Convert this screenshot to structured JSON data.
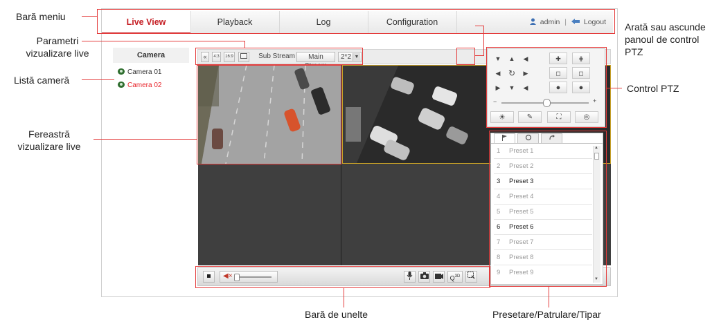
{
  "menu": {
    "tabs": [
      {
        "label": "Live View",
        "active": true
      },
      {
        "label": "Playback",
        "active": false
      },
      {
        "label": "Log",
        "active": false
      },
      {
        "label": "Configuration",
        "active": false
      }
    ],
    "user": "admin",
    "separator": "|",
    "logout": "Logout"
  },
  "camera_panel": {
    "title": "Camera",
    "items": [
      {
        "label": "Camera 01",
        "active": false
      },
      {
        "label": "Camera 02",
        "active": true
      }
    ]
  },
  "liveview_toolbar": {
    "collapse_left": "«",
    "ratio_4_3": "4:3",
    "ratio_16_9": "16:9",
    "sub_stream": "Sub Stream",
    "main_stream": "Main Stream",
    "layout": "2*2",
    "expand_right": "»"
  },
  "bottom_toolbar": {
    "stop_icon": "stop-icon",
    "volume_icon": "speaker-mute-icon",
    "icons": [
      "microphone-icon",
      "camera-icon",
      "record-icon",
      "zoom-icon",
      "capture-region-icon"
    ],
    "zoom_badge": "3D"
  },
  "ptz": {
    "icons": [
      "arrow-nw",
      "arrow-n",
      "arrow-ne",
      "arrow-w",
      "auto-rotate",
      "arrow-e",
      "arrow-sw",
      "arrow-s",
      "arrow-se"
    ],
    "minus": "−",
    "plus": "+"
  },
  "presets": {
    "tabs": [
      "preset-tab",
      "patrol-tab",
      "pattern-tab"
    ],
    "rows": [
      {
        "num": "1",
        "label": "Preset 1",
        "set": false
      },
      {
        "num": "2",
        "label": "Preset 2",
        "set": false
      },
      {
        "num": "3",
        "label": "Preset 3",
        "set": true
      },
      {
        "num": "4",
        "label": "Preset 4",
        "set": false
      },
      {
        "num": "5",
        "label": "Preset 5",
        "set": false
      },
      {
        "num": "6",
        "label": "Preset 6",
        "set": true
      },
      {
        "num": "7",
        "label": "Preset 7",
        "set": false
      },
      {
        "num": "8",
        "label": "Preset 8",
        "set": false
      },
      {
        "num": "9",
        "label": "Preset 9",
        "set": false
      }
    ]
  },
  "callouts": {
    "menu_bar": "Bară meniu",
    "liveview_params": [
      "Parametri",
      "vizualizare live"
    ],
    "camera_list": "Listă cameră",
    "live_window": [
      "Fereastră",
      "vizualizare live"
    ],
    "show_hide_ptz": [
      "Arată sau ascunde",
      "panoul de control",
      "PTZ"
    ],
    "ptz_control": "Control PTZ",
    "toolbar": "Bară de unelte",
    "preset_patrol": "Presetare/Patrulare/Tipar"
  },
  "colors": {
    "accent": "#c62127",
    "callout": "#e43b3b",
    "active_camera": "#e8262c"
  }
}
